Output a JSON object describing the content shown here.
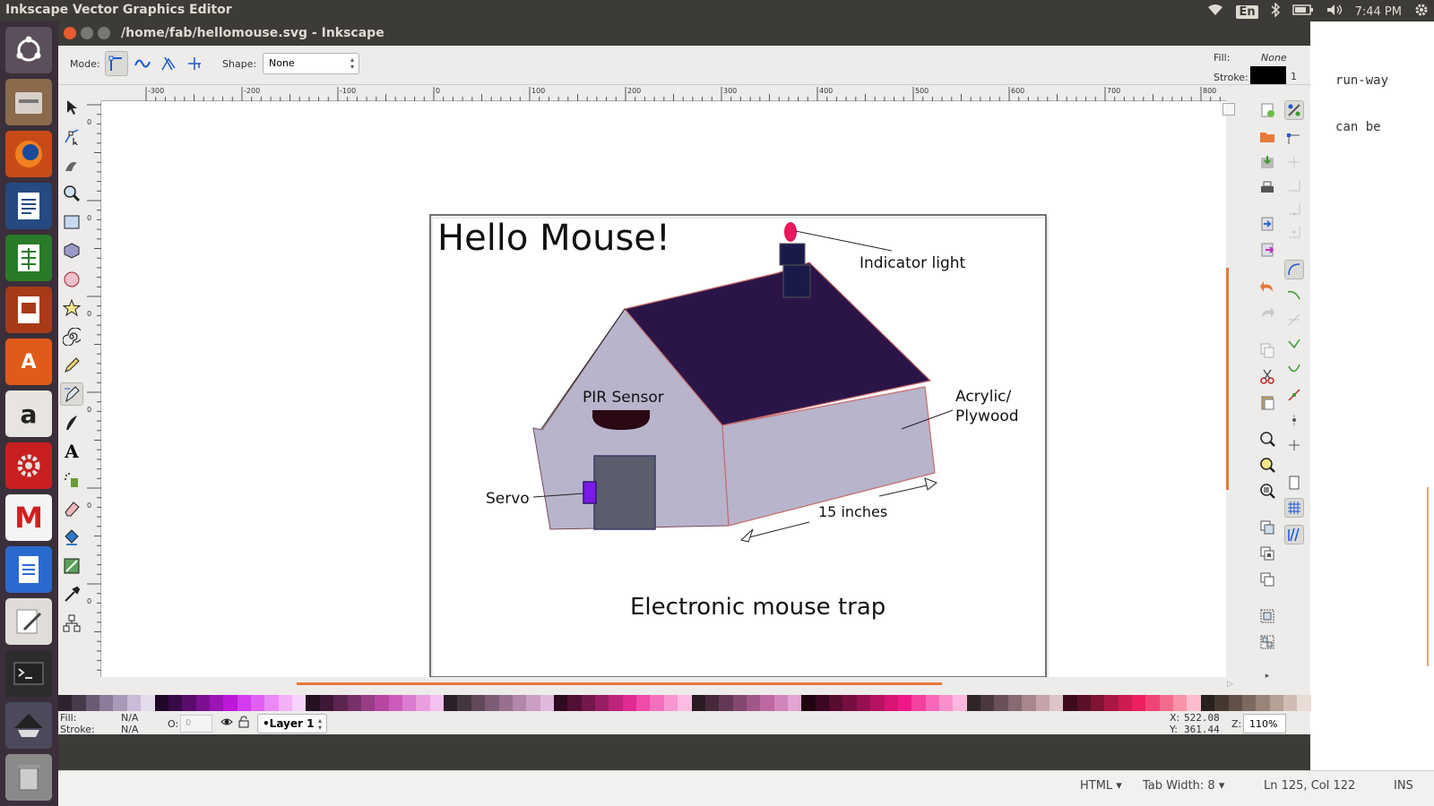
{
  "topbar": {
    "app_title": "Inkscape Vector Graphics Editor",
    "lang": "En",
    "time": "7:44 PM"
  },
  "window": {
    "title": "/home/fab/hellomouse.svg - Inkscape"
  },
  "toolctrl": {
    "mode_label": "Mode:",
    "shape_label": "Shape:",
    "shape_value": "None",
    "fill_label": "Fill:",
    "fill_value": "None",
    "stroke_label": "Stroke:",
    "stroke_width": "1",
    "stroke_color": "#000000"
  },
  "ruler": {
    "h_ticks": [
      "-300",
      "-200",
      "-100",
      "0",
      "100",
      "200",
      "300",
      "400",
      "500",
      "600",
      "700",
      "800"
    ],
    "v_ticks": [
      "0",
      "0",
      "0",
      "0",
      "0",
      "0",
      "0",
      "0"
    ]
  },
  "drawing": {
    "heading": "Hello Mouse!",
    "indicator_label": "Indicator light",
    "pir_label": "PIR Sensor",
    "acrylic_line1": "Acrylic/",
    "acrylic_line2": "Plywood",
    "servo_label": "Servo",
    "dimension_label": "15 inches",
    "caption": "Electronic mouse trap",
    "roof_color": "#2b1548",
    "wall_color": "#b8b4cc",
    "door_color": "#5a5e6c",
    "indicator_color": "#e8185a"
  },
  "statusbar": {
    "fill_label": "Fill:",
    "fill_value": "N/A",
    "stroke_label": "Stroke:",
    "stroke_value": "N/A",
    "opacity_label": "O:",
    "opacity_value": "0",
    "layer": "•Layer 1",
    "x_label": "X:",
    "x_value": "522.08",
    "y_label": "Y:",
    "y_value": "361.44",
    "zoom_label": "Z:",
    "zoom_value": "110%"
  },
  "bgapp": {
    "line1": "run-way",
    "line2": "can be",
    "lang_mode": "HTML ▾",
    "tab_width": "Tab Width: 8 ▾",
    "position": "Ln 125, Col 122",
    "ins": "INS"
  },
  "palette": [
    "#2d2330",
    "#463a4a",
    "#6a5a72",
    "#8c7c99",
    "#a89ab8",
    "#c8bcd6",
    "#e4dcec",
    "#200828",
    "#3a0a48",
    "#5a0c6c",
    "#7c1090",
    "#9c14b4",
    "#bc18d8",
    "#d43cf0",
    "#e060f4",
    "#ec88f8",
    "#f4b0fa",
    "#f8d4fc",
    "#241020",
    "#3e1836",
    "#5c2450",
    "#7a306a",
    "#983c86",
    "#b648a2",
    "#cc5cbc",
    "#dc7cd0",
    "#ea9ee0",
    "#f4c0ee",
    "#2a2028",
    "#443640",
    "#60485a",
    "#7c5c74",
    "#98708e",
    "#b486aa",
    "#cc9ec4",
    "#e0badc",
    "#300a20",
    "#501034",
    "#74184c",
    "#981e64",
    "#bc247c",
    "#e02a94",
    "#f04aaa",
    "#f470bc",
    "#f896d0",
    "#fcbce2",
    "#2a1a22",
    "#46283a",
    "#643854",
    "#82486e",
    "#a05888",
    "#be68a2",
    "#d284bc",
    "#e2a4d2",
    "#200410",
    "#3a0820",
    "#580c30",
    "#760e40",
    "#961050",
    "#b81262",
    "#d81474",
    "#f01888",
    "#f440a0",
    "#f868b8",
    "#fc90cc",
    "#feb8e0",
    "#302428",
    "#4a383e",
    "#6a5058",
    "#886a72",
    "#a8868e",
    "#c4a4aa",
    "#dcc4c8",
    "#3c0c1c",
    "#5c1028",
    "#801434",
    "#a81842",
    "#cc1c50",
    "#ec2060",
    "#f04474",
    "#f46c8c",
    "#f892a8",
    "#fcbccc",
    "#28201c",
    "#443830",
    "#605048",
    "#7c6a60",
    "#988478",
    "#b4a094",
    "#d0bcb2",
    "#e8dcd4"
  ]
}
